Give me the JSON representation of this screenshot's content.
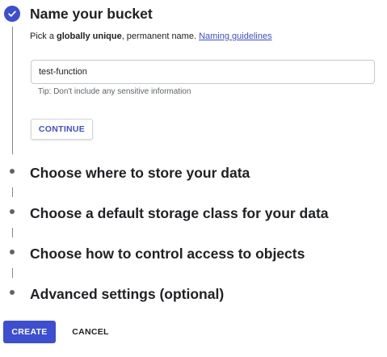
{
  "step1": {
    "title": "Name your bucket",
    "description_prefix": "Pick a ",
    "description_bold": "globally unique",
    "description_suffix": ", permanent name. ",
    "naming_link": "Naming guidelines",
    "input_value": "test-function",
    "tip": "Tip: Don't include any sensitive information",
    "continue_label": "CONTINUE"
  },
  "steps": [
    {
      "title": "Choose where to store your data"
    },
    {
      "title": "Choose a default storage class for your data"
    },
    {
      "title": "Choose how to control access to objects"
    },
    {
      "title": "Advanced settings (optional)"
    }
  ],
  "actions": {
    "create_label": "CREATE",
    "cancel_label": "CANCEL"
  },
  "colors": {
    "accent": "#3c4fd0",
    "text": "#202124",
    "muted": "#5f6368"
  },
  "icons": {
    "step1_complete": "check-circle-icon",
    "pending_step": "dot-icon"
  }
}
